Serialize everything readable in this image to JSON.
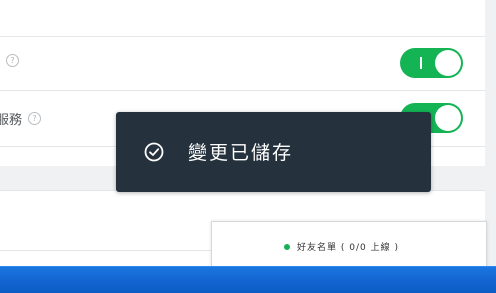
{
  "settings": {
    "rows": [
      {
        "label": "",
        "help_icon": "question-icon",
        "toggle_on": true
      },
      {
        "label": "服務",
        "help_icon": "question-icon",
        "toggle_on": true
      }
    ]
  },
  "toast": {
    "icon": "check-circle-icon",
    "message": "變更已儲存"
  },
  "friends_list": {
    "status_color": "#16b157",
    "label": "好友名單 ( 0/0 上線 )"
  },
  "colors": {
    "toggle_on": "#14b455",
    "toast_bg": "#25313c",
    "taskbar": "#1263cf"
  }
}
